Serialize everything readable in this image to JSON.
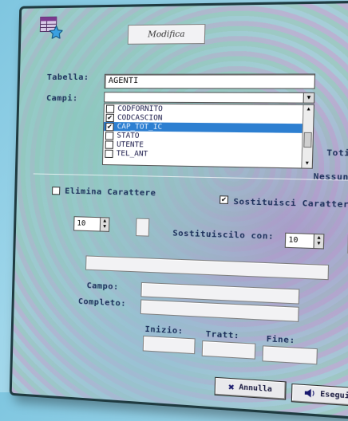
{
  "title": "Modifica",
  "labels": {
    "tabella": "Tabella:",
    "campi": "Campi:",
    "toti": "Toti",
    "nessuno": "Nessuno",
    "elimina": "Elimina Carattere",
    "sostituisci": "Sostituisci Carattere",
    "sostituiscilo": "Sostituiscilo con:",
    "campo": "Campo:",
    "completo": "Completo:",
    "inizio": "Inizio:",
    "tratto": "Tratt:",
    "fine": "Fine:"
  },
  "tabella_value": "AGENTI",
  "fields": [
    {
      "label": "CODFORNITO",
      "checked": false,
      "selected": false
    },
    {
      "label": "CODCASCION",
      "checked": true,
      "selected": false
    },
    {
      "label": "CAP_TOT_IC",
      "checked": true,
      "selected": true
    },
    {
      "label": "STATO",
      "checked": false,
      "selected": false
    },
    {
      "label": "UTENTE",
      "checked": false,
      "selected": false
    },
    {
      "label": "TEL_ANT",
      "checked": false,
      "selected": false
    }
  ],
  "elimina_checked": false,
  "sostituisci_checked": true,
  "spin_left": "10",
  "spin_right": "10",
  "buttons": {
    "annulla": "Annulla",
    "esegui": "Esegui"
  },
  "colors": {
    "selection": "#2d7fd1",
    "label_text": "#1b2f5a",
    "annulla_icon": "#1a1a6e"
  },
  "icons": {
    "app": "table-star-icon",
    "annulla": "x-icon",
    "esegui": "speaker-icon"
  }
}
